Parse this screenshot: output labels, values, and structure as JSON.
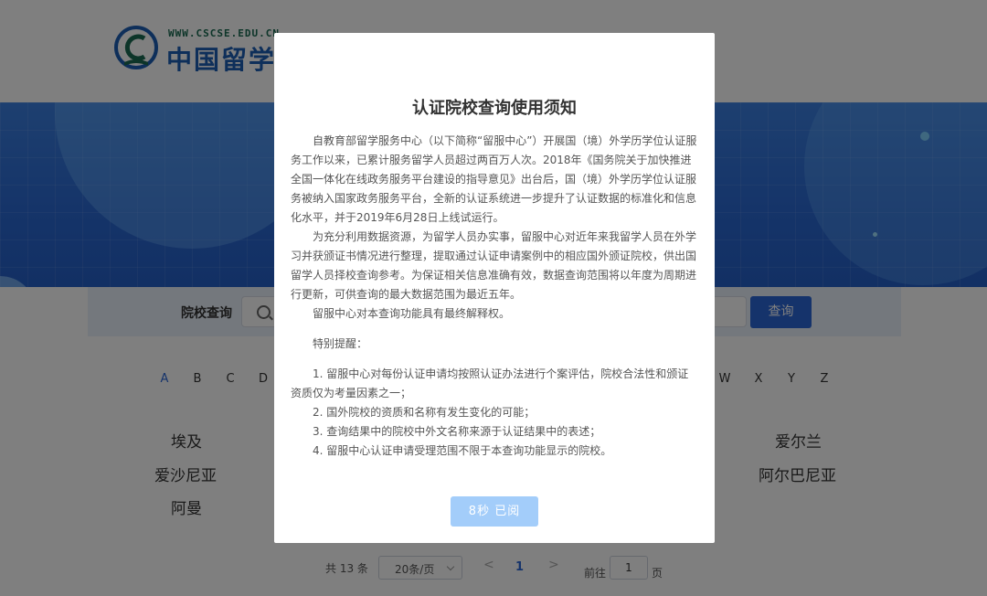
{
  "header": {
    "logo_url": "WWW.CSCSE.EDU.CN",
    "logo_name": "中国留学网"
  },
  "search": {
    "label": "院校查询",
    "placeholder": "",
    "button": "查询"
  },
  "alphabet": {
    "active": "A",
    "left": [
      "A",
      "B",
      "C",
      "D"
    ],
    "right": [
      "W",
      "X",
      "Y",
      "Z"
    ]
  },
  "countries": {
    "left": [
      "埃及",
      "爱沙尼亚",
      "阿曼"
    ],
    "right": [
      "爱尔兰",
      "阿尔巴尼亚"
    ]
  },
  "pagination": {
    "total": "共 13 条",
    "page_size": "20条/页",
    "prev": "<",
    "current": "1",
    "next": ">",
    "goto_label": "前往",
    "goto_value": "1",
    "page_suffix": "页"
  },
  "modal": {
    "title": "认证院校查询使用须知",
    "paragraphs": [
      "自教育部留学服务中心（以下简称“留服中心”）开展国（境）外学历学位认证服务工作以来，已累计服务留学人员超过两百万人次。2018年《国务院关于加快推进全国一体化在线政务服务平台建设的指导意见》出台后，国（境）外学历学位认证服务被纳入国家政务服务平台，全新的认证系统进一步提升了认证数据的标准化和信息化水平，并于2019年6月28日上线试运行。",
      "为充分利用数据资源，为留学人员办实事，留服中心对近年来我留学人员在外学习并获颁证书情况进行整理，提取通过认证申请案例中的相应国外颁证院校，供出国留学人员择校查询参考。为保证相关信息准确有效，数据查询范围将以年度为周期进行更新，可供查询的最大数据范围为最近五年。",
      "留服中心对本查询功能具有最终解释权。"
    ],
    "reminder_title": "特别提醒：",
    "reminders": [
      "1. 留服中心对每份认证申请均按照认证办法进行个案评估，院校合法性和颁证资质仅为考量因素之一；",
      "2. 国外院校的资质和名称有发生变化的可能；",
      "3. 查询结果中的院校中外文名称来源于认证结果中的表述；",
      "4. 留服中心认证申请受理范围不限于本查询功能显示的院校。"
    ],
    "button": "8秒 已阅"
  },
  "colors": {
    "primary": "#2b67d6",
    "disabled_button": "#a3cdfa",
    "overlay": "rgba(0,0,0,0.5)"
  }
}
